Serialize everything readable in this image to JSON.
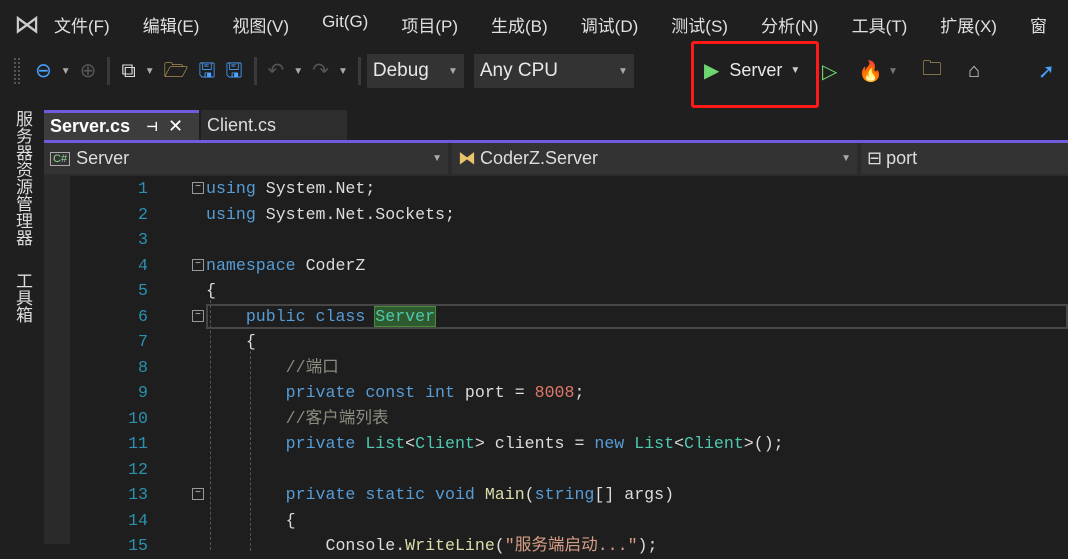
{
  "menu": [
    "文件(F)",
    "编辑(E)",
    "视图(V)",
    "Git(G)",
    "项目(P)",
    "生成(B)",
    "调试(D)",
    "测试(S)",
    "分析(N)",
    "工具(T)",
    "扩展(X)",
    "窗"
  ],
  "toolbar": {
    "config": "Debug",
    "platform": "Any CPU",
    "run_target": "Server"
  },
  "sidebar": {
    "server_explorer": "服务器资源管理器",
    "toolbox": "工具箱"
  },
  "tabs": [
    {
      "label": "Server.cs",
      "active": true
    },
    {
      "label": "Client.cs",
      "active": false
    }
  ],
  "navbar": {
    "project": "Server",
    "type": "CoderZ.Server",
    "member": "port"
  },
  "code": [
    {
      "n": "1",
      "fold": "−",
      "t": [
        [
          "kw",
          "using"
        ],
        [
          "id",
          " System.Net;"
        ]
      ]
    },
    {
      "n": "2",
      "t": [
        [
          "kw",
          "using"
        ],
        [
          "id",
          " System.Net.Sockets;"
        ]
      ]
    },
    {
      "n": "3",
      "t": []
    },
    {
      "n": "4",
      "fold": "−",
      "t": [
        [
          "kw",
          "namespace"
        ],
        [
          "id",
          " CoderZ"
        ]
      ]
    },
    {
      "n": "5",
      "t": [
        [
          "id",
          "{"
        ]
      ]
    },
    {
      "n": "6",
      "fold": "−",
      "hl": true,
      "t": [
        [
          "id",
          "    "
        ],
        [
          "kw",
          "public class "
        ],
        [
          "sel",
          "Server"
        ]
      ]
    },
    {
      "n": "7",
      "t": [
        [
          "id",
          "    {"
        ]
      ]
    },
    {
      "n": "8",
      "t": [
        [
          "cm",
          "        //端口"
        ]
      ]
    },
    {
      "n": "9",
      "t": [
        [
          "kw",
          "        private const int "
        ],
        [
          "id",
          "port = "
        ],
        [
          "nu",
          "8008"
        ],
        [
          "id",
          ";"
        ]
      ]
    },
    {
      "n": "10",
      "t": [
        [
          "cm",
          "        //客户端列表"
        ]
      ]
    },
    {
      "n": "11",
      "t": [
        [
          "kw",
          "        private "
        ],
        [
          "ty",
          "List"
        ],
        [
          "id",
          "<"
        ],
        [
          "ty",
          "Client"
        ],
        [
          "id",
          "> clients = "
        ],
        [
          "kw",
          "new "
        ],
        [
          "ty",
          "List"
        ],
        [
          "id",
          "<"
        ],
        [
          "ty",
          "Client"
        ],
        [
          "id",
          ">();"
        ]
      ]
    },
    {
      "n": "12",
      "t": []
    },
    {
      "n": "13",
      "fold": "−",
      "t": [
        [
          "kw",
          "        private static void "
        ],
        [
          "fn",
          "Main"
        ],
        [
          "id",
          "("
        ],
        [
          "kw",
          "string"
        ],
        [
          "id",
          "[] args)"
        ]
      ]
    },
    {
      "n": "14",
      "t": [
        [
          "id",
          "        {"
        ]
      ]
    },
    {
      "n": "15",
      "t": [
        [
          "id",
          "            Console."
        ],
        [
          "fn",
          "WriteLine"
        ],
        [
          "id",
          "("
        ],
        [
          "st",
          "\"服务端启动...\""
        ],
        [
          "id",
          ");"
        ]
      ]
    }
  ]
}
